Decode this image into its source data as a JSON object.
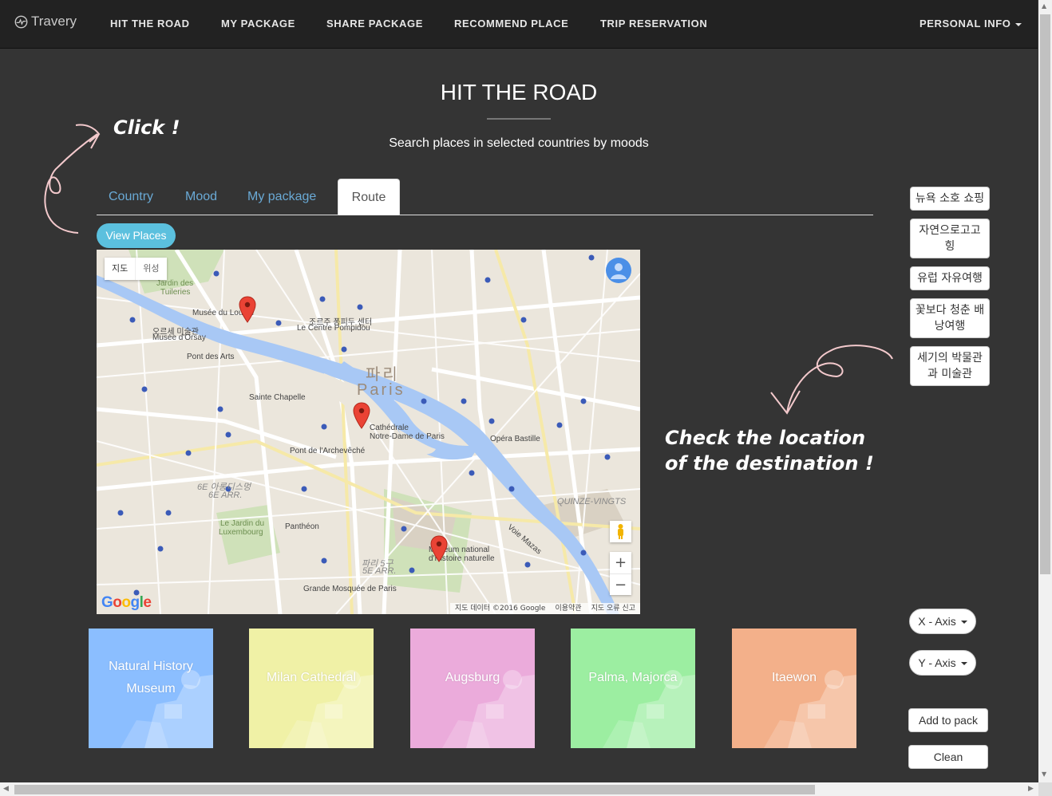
{
  "nav": {
    "brand": "Travery",
    "items": [
      "HIT THE ROAD",
      "MY PACKAGE",
      "SHARE PACKAGE",
      "RECOMMEND PLACE",
      "TRIP RESERVATION"
    ],
    "personal": "PERSONAL INFO"
  },
  "header": {
    "title": "HIT THE ROAD",
    "subtitle": "Search places in selected countries by moods"
  },
  "annotations": {
    "click": "Click !",
    "check_line1": "Check the location",
    "check_line2": "of the destination !"
  },
  "tabs": [
    "Country",
    "Mood",
    "My package",
    "Route"
  ],
  "active_tab": "Route",
  "view_places": "View Places",
  "map": {
    "type_map": "지도",
    "type_satellite": "위성",
    "footer_data": "지도 데이터 ©2016 Google",
    "footer_terms": "이용약관",
    "footer_report": "지도 오류 신고",
    "google": "Google",
    "labels": {
      "jardin": "Jardin des",
      "tuileries": "Tuileries",
      "louvre": "Musée du Louvre",
      "pompidou_kr": "조르주 퐁피두 센터",
      "pompidou": "Le Centre Pompidou",
      "orsay_kr": "오르세 미술관",
      "orsay": "Musée d'Orsay",
      "pont_arts": "Pont des Arts",
      "paris_kr": "파리",
      "paris": "Paris",
      "chapelle": "Sainte Chapelle",
      "notre1": "Cathédrale",
      "notre2": "Notre-Dame de Paris",
      "bastille": "Opéra Bastille",
      "archeveche": "Pont de l'Archevêché",
      "arr6_kr": "6E 아롱디스멍",
      "arr6": "6E ARR.",
      "luxembourg1": "Le Jardin du",
      "luxembourg2": "Luxembourg",
      "pantheon": "Panthéon",
      "museum1": "Muséum national",
      "museum2": "d'Histoire naturelle",
      "arr5_kr": "파리 5구",
      "arr5": "5E ARR.",
      "mosquee": "Grande Mosquée de Paris",
      "quinze": "QUINZE-VINGTS",
      "voie": "Voie Mazas"
    }
  },
  "side_moods": [
    "뉴욕 소호 쇼핑",
    "자연으로고고 힝",
    "유럽 자유여행",
    "꽃보다 청춘 배낭여행",
    "세기의 박물관과 미술관"
  ],
  "controls": {
    "x_axis": "X - Axis",
    "y_axis": "Y - Axis",
    "add": "Add to pack",
    "clean": "Clean"
  },
  "cards": [
    {
      "name": "Natural History Museum",
      "line1": "Natural History",
      "line2": "Museum",
      "color": "#7cb6ff"
    },
    {
      "name": "Milan Cathedral",
      "line1": "Milan Cathedral",
      "line2": "",
      "color": "#eef09a"
    },
    {
      "name": "Augsburg",
      "line1": "Augsburg",
      "line2": "",
      "color": "#e9a0d6"
    },
    {
      "name": "Palma, Majorca",
      "line1": "Palma, Majorca",
      "line2": "",
      "color": "#8fec95"
    },
    {
      "name": "Itaewon",
      "line1": "Itaewon",
      "line2": "",
      "color": "#f2a57a"
    }
  ]
}
